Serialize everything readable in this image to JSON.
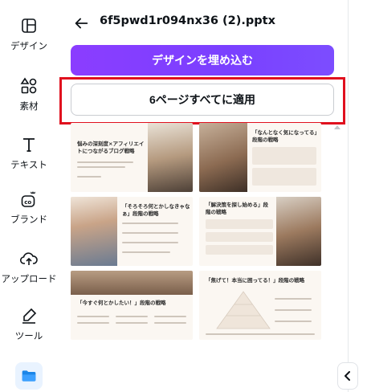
{
  "sidebar": {
    "items": [
      {
        "label": "デザイン",
        "icon": "design-icon"
      },
      {
        "label": "素材",
        "icon": "elements-icon"
      },
      {
        "label": "テキスト",
        "icon": "text-icon"
      },
      {
        "label": "ブランド",
        "icon": "brand-icon"
      },
      {
        "label": "アップロード",
        "icon": "upload-icon"
      },
      {
        "label": "ツール",
        "icon": "tools-icon"
      }
    ],
    "folder_icon": "folder-icon"
  },
  "panel": {
    "file_title": "6f5pwd1r094nx36 (2).pptx",
    "embed_button": "デザインを埋め込む",
    "apply_button": "6ページすべてに適用"
  },
  "thumbnails": [
    {
      "title": "悩みの深刻度×アフィリエイトにつながるブログ戦略"
    },
    {
      "title": "「なんとなく気になってる」段階の戦略"
    },
    {
      "title": "「そろそろ何とかしなきゃなぁ」段階の戦略"
    },
    {
      "title": "「解決策を探し始める」段階の戦略"
    },
    {
      "title": "「今すぐ何とかしたい！」段階の戦略"
    },
    {
      "title": "「焦げて！本当に困ってる！」段階の戦略"
    }
  ],
  "colors": {
    "accent": "#8b3dff",
    "highlight": "#e0101e"
  }
}
